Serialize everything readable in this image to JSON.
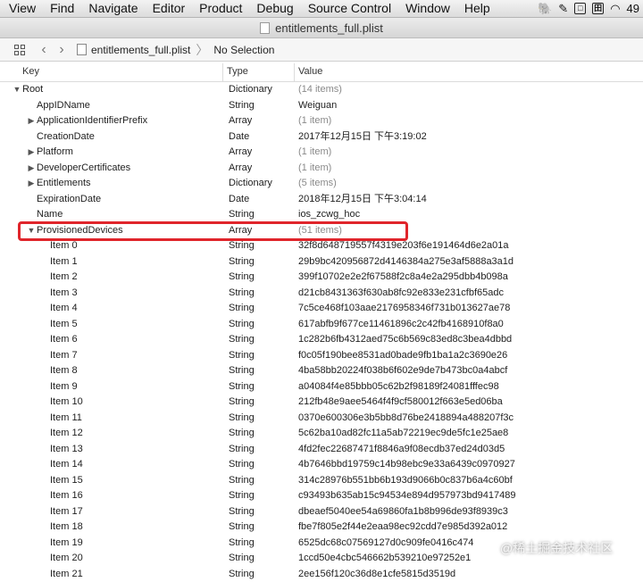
{
  "menubar": {
    "items": [
      "View",
      "Find",
      "Navigate",
      "Editor",
      "Product",
      "Debug",
      "Source Control",
      "Window",
      "Help"
    ],
    "status_icons": [
      "evernote-icon",
      "pen-icon",
      "keyboard-icon",
      "input-method-icon",
      "wifi-icon"
    ],
    "clock_fragment": "49"
  },
  "titlebar": {
    "title": "entitlements_full.plist"
  },
  "jumpbar": {
    "file": "entitlements_full.plist",
    "selection": "No Selection"
  },
  "columns": {
    "key": "Key",
    "type": "Type",
    "value": "Value"
  },
  "rows": [
    {
      "key": "Root",
      "type": "Dictionary",
      "value": "(14 items)",
      "indent": 0,
      "disclosure": "open",
      "muted": true
    },
    {
      "key": "AppIDName",
      "type": "String",
      "value": "Weiguan",
      "indent": 1,
      "disclosure": "none",
      "muted": false
    },
    {
      "key": "ApplicationIdentifierPrefix",
      "type": "Array",
      "value": "(1 item)",
      "indent": 1,
      "disclosure": "closed",
      "muted": true
    },
    {
      "key": "CreationDate",
      "type": "Date",
      "value": "2017年12月15日 下午3:19:02",
      "indent": 1,
      "disclosure": "none",
      "muted": false
    },
    {
      "key": "Platform",
      "type": "Array",
      "value": "(1 item)",
      "indent": 1,
      "disclosure": "closed",
      "muted": true
    },
    {
      "key": "DeveloperCertificates",
      "type": "Array",
      "value": "(1 item)",
      "indent": 1,
      "disclosure": "closed",
      "muted": true
    },
    {
      "key": "Entitlements",
      "type": "Dictionary",
      "value": "(5 items)",
      "indent": 1,
      "disclosure": "closed",
      "muted": true
    },
    {
      "key": "ExpirationDate",
      "type": "Date",
      "value": "2018年12月15日 下午3:04:14",
      "indent": 1,
      "disclosure": "none",
      "muted": false
    },
    {
      "key": "Name",
      "type": "String",
      "value": "ios_zcwg_hoc",
      "indent": 1,
      "disclosure": "none",
      "muted": false
    },
    {
      "key": "ProvisionedDevices",
      "type": "Array",
      "value": "(51 items)",
      "indent": 1,
      "disclosure": "open",
      "muted": true
    },
    {
      "key": "Item 0",
      "type": "String",
      "value": "32f8d648719557f4319e203f6e191464d6e2a01a",
      "indent": 2,
      "disclosure": "none",
      "muted": false
    },
    {
      "key": "Item 1",
      "type": "String",
      "value": "29b9bc420956872d4146384a275e3af5888a3a1d",
      "indent": 2,
      "disclosure": "none",
      "muted": false
    },
    {
      "key": "Item 2",
      "type": "String",
      "value": "399f10702e2e2f67588f2c8a4e2a295dbb4b098a",
      "indent": 2,
      "disclosure": "none",
      "muted": false
    },
    {
      "key": "Item 3",
      "type": "String",
      "value": "d21cb8431363f630ab8fc92e833e231cfbf65adc",
      "indent": 2,
      "disclosure": "none",
      "muted": false
    },
    {
      "key": "Item 4",
      "type": "String",
      "value": "7c5ce468f103aae2176958346f731b013627ae78",
      "indent": 2,
      "disclosure": "none",
      "muted": false
    },
    {
      "key": "Item 5",
      "type": "String",
      "value": "617abfb9f677ce11461896c2c42fb4168910f8a0",
      "indent": 2,
      "disclosure": "none",
      "muted": false
    },
    {
      "key": "Item 6",
      "type": "String",
      "value": "1c282b6fb4312aed75c6b569c83ed8c3bea4dbbd",
      "indent": 2,
      "disclosure": "none",
      "muted": false
    },
    {
      "key": "Item 7",
      "type": "String",
      "value": "f0c05f190bee8531ad0bade9fb1ba1a2c3690e26",
      "indent": 2,
      "disclosure": "none",
      "muted": false
    },
    {
      "key": "Item 8",
      "type": "String",
      "value": "4ba58bb20224f038b6f602e9de7b473bc0a4abcf",
      "indent": 2,
      "disclosure": "none",
      "muted": false
    },
    {
      "key": "Item 9",
      "type": "String",
      "value": "a04084f4e85bbb05c62b2f98189f24081fffec98",
      "indent": 2,
      "disclosure": "none",
      "muted": false
    },
    {
      "key": "Item 10",
      "type": "String",
      "value": "212fb48e9aee5464f4f9cf580012f663e5ed06ba",
      "indent": 2,
      "disclosure": "none",
      "muted": false
    },
    {
      "key": "Item 11",
      "type": "String",
      "value": "0370e600306e3b5bb8d76be2418894a488207f3c",
      "indent": 2,
      "disclosure": "none",
      "muted": false
    },
    {
      "key": "Item 12",
      "type": "String",
      "value": "5c62ba10ad82fc11a5ab72219ec9de5fc1e25ae8",
      "indent": 2,
      "disclosure": "none",
      "muted": false
    },
    {
      "key": "Item 13",
      "type": "String",
      "value": "4fd2fec22687471f8846a9f08ecdb37ed24d03d5",
      "indent": 2,
      "disclosure": "none",
      "muted": false
    },
    {
      "key": "Item 14",
      "type": "String",
      "value": "4b7646bbd19759c14b98ebc9e33a6439c0970927",
      "indent": 2,
      "disclosure": "none",
      "muted": false
    },
    {
      "key": "Item 15",
      "type": "String",
      "value": "314c28976b551bb6b193d9066b0c837b6a4c60bf",
      "indent": 2,
      "disclosure": "none",
      "muted": false
    },
    {
      "key": "Item 16",
      "type": "String",
      "value": "c93493b635ab15c94534e894d957973bd9417489",
      "indent": 2,
      "disclosure": "none",
      "muted": false
    },
    {
      "key": "Item 17",
      "type": "String",
      "value": "dbeaef5040ee54a69860fa1b8b996de93f8939c3",
      "indent": 2,
      "disclosure": "none",
      "muted": false
    },
    {
      "key": "Item 18",
      "type": "String",
      "value": "fbe7f805e2f44e2eaa98ec92cdd7e985d392a012",
      "indent": 2,
      "disclosure": "none",
      "muted": false
    },
    {
      "key": "Item 19",
      "type": "String",
      "value": "6525dc68c07569127d0c909fe0416c474",
      "indent": 2,
      "disclosure": "none",
      "muted": false
    },
    {
      "key": "Item 20",
      "type": "String",
      "value": "1ccd50e4cbc546662b539210e97252e1",
      "indent": 2,
      "disclosure": "none",
      "muted": false
    },
    {
      "key": "Item 21",
      "type": "String",
      "value": "2ee156f120c36d8e1cfe5815d3519d",
      "indent": 2,
      "disclosure": "none",
      "muted": false
    }
  ],
  "watermark": "@稀土掘金技术社区",
  "colors": {
    "highlight": "#e0252b",
    "muted": "#8a8a8a"
  }
}
